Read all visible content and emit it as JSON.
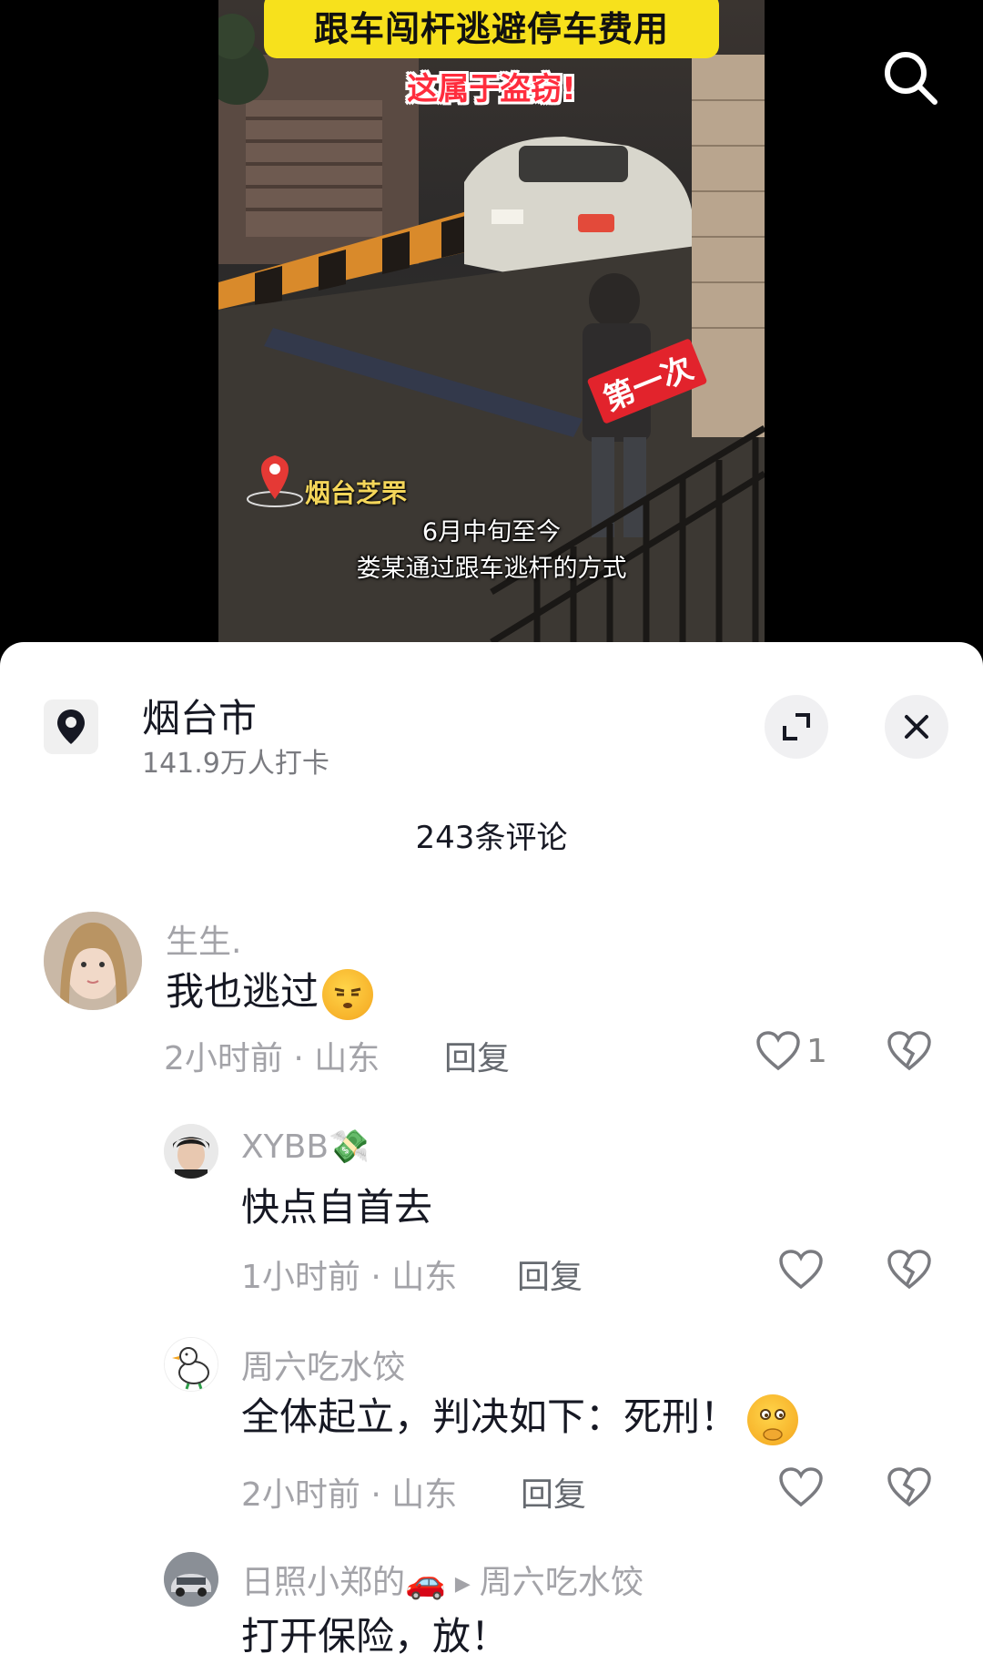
{
  "video": {
    "title_banner": "跟车闯杆逃避停车费用",
    "subtitle_red": "这属于盗窃!",
    "first_tag": "第一次",
    "location_tag": "烟台芝罘",
    "caption_line1": "6月中旬至今",
    "caption_line2": "娄某通过跟车逃杆的方式"
  },
  "header": {
    "search_icon": "search-icon"
  },
  "location": {
    "name": "烟台市",
    "checkins": "141.9万人打卡",
    "icon": "location-pin-icon"
  },
  "comments_header": {
    "count_label": "243条评论"
  },
  "comments": [
    {
      "user": "生生.",
      "text": "我也逃过",
      "emoji": "smirk-emoji",
      "time": "2小时前",
      "region": "山东",
      "reply_label": "回复",
      "likes": "1"
    }
  ],
  "replies": [
    {
      "user": "XYBB💸",
      "text": "快点自首去",
      "time": "1小时前",
      "region": "山东",
      "reply_label": "回复"
    },
    {
      "user": "周六吃水饺",
      "text": "全体起立，判决如下：死刑！",
      "emoji": "thinking-emoji",
      "time": "2小时前",
      "region": "山东",
      "reply_label": "回复"
    },
    {
      "user": "日照小郑的🚗",
      "reply_to": "周六吃水饺",
      "text": "打开保险，放！"
    }
  ],
  "meta_separator": " · ",
  "colors": {
    "panel_bg": "#ffffff",
    "text_primary": "#161823",
    "text_secondary": "#a3a3a8",
    "banner_yellow": "#f7e11c",
    "alert_red": "#ff2d3d"
  }
}
